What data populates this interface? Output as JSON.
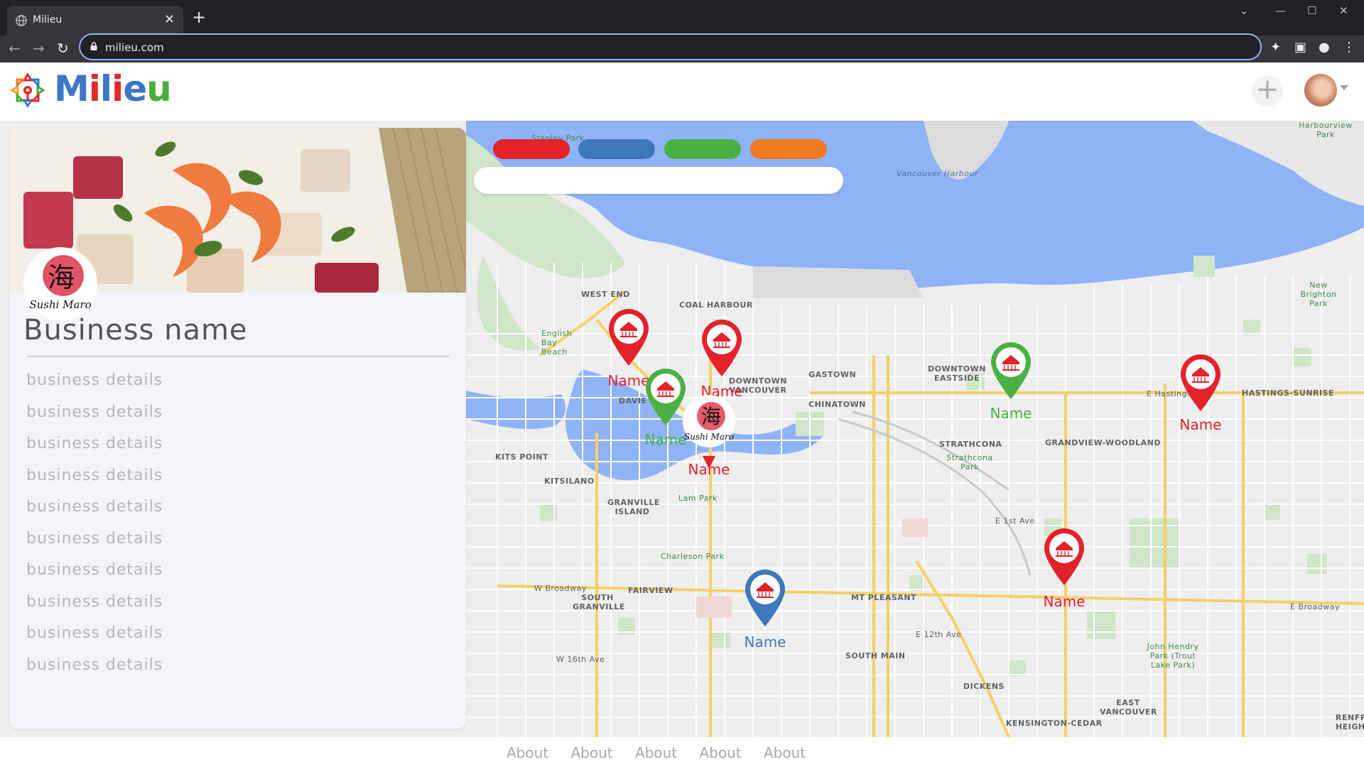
{
  "browser": {
    "tab_title": "Milieu",
    "url": "milieu.com"
  },
  "header": {
    "logo_letters": [
      "M",
      "i",
      "l",
      "i",
      "e",
      "u"
    ],
    "logo_colors": [
      "#3b76c7",
      "#e02a2a",
      "#3b76c7",
      "#e02a2a",
      "#3b76c7",
      "#49ad3f"
    ]
  },
  "filters": {
    "pills": [
      {
        "color": "#e3222b"
      },
      {
        "color": "#3e78bb"
      },
      {
        "color": "#4bb043"
      },
      {
        "color": "#f07b23"
      }
    ],
    "search_value": ""
  },
  "map": {
    "labels": {
      "stanley_park": "Stanley Park",
      "vancouver_harbour": "Vancouver Harbour",
      "harbourview_park": "Harbourview Park",
      "west_end": "WEST END",
      "coal_harbour": "COAL HARBOUR",
      "english_bay_beach": "English Bay Beach",
      "downtown_vancouver": "DOWNTOWN VANCOUVER",
      "gastown": "GASTOWN",
      "downtown_eastside": "DOWNTOWN EASTSIDE",
      "davie": "DAVIE",
      "chinatown": "CHINATOWN",
      "kits_point": "KITS POINT",
      "kitsilano": "KITSILANO",
      "granville_island": "GRANVILLE ISLAND",
      "lam_park": "Lam Park",
      "charleson_park": "Charleson Park",
      "strathcona": "STRATHCONA",
      "strathcona_park": "Strathcona Park",
      "grandview_woodland": "GRANDVIEW-WOODLAND",
      "hastings_sunrise": "HASTINGS-SUNRISE",
      "new_brighton_park": "New Brighton Park",
      "fairview": "FAIRVIEW",
      "south_granville": "SOUTH GRANVILLE",
      "mt_pleasant": "MT PLEASANT",
      "south_main": "SOUTH MAIN",
      "dickens": "DICKENS",
      "john_hendry_park": "John Hendry Park (Trout Lake Park)",
      "east_vancouver": "EAST VANCOUVER",
      "kensington_cedar": "KENSINGTON-CEDAR",
      "e_hastings_st": "E Hastings St",
      "e_broadway": "E Broadway",
      "w_broadway": "W Broadway",
      "e_1st_ave": "E 1st Ave",
      "e_12th_ave": "E 12th Ave",
      "w_16th_ave": "W 16th Ave",
      "renfrew_heights": "RENFREW HEIGHTS"
    },
    "pins": [
      {
        "label": "Name",
        "color": "#e3222b"
      },
      {
        "label": "Name",
        "color": "#e3222b"
      },
      {
        "label": "Name",
        "color": "#4bb043"
      },
      {
        "label": "Name",
        "color": "#e3222b"
      },
      {
        "label": "Name",
        "color": "#4bb043"
      },
      {
        "label": "Name",
        "color": "#e3222b"
      },
      {
        "label": "Name",
        "color": "#e3222b"
      },
      {
        "label": "Name",
        "color": "#3e78bb"
      }
    ],
    "selected_pin_logo_text": "Sushi Maro"
  },
  "business": {
    "logo_glyph": "海",
    "logo_text": "Sushi Maro",
    "name": "Business name",
    "details": [
      "business details",
      "business details",
      "business details",
      "business details",
      "business details",
      "business details",
      "business details",
      "business details",
      "business details",
      "business details"
    ]
  },
  "footer": {
    "links": [
      "About",
      "About",
      "About",
      "About",
      "About"
    ]
  }
}
